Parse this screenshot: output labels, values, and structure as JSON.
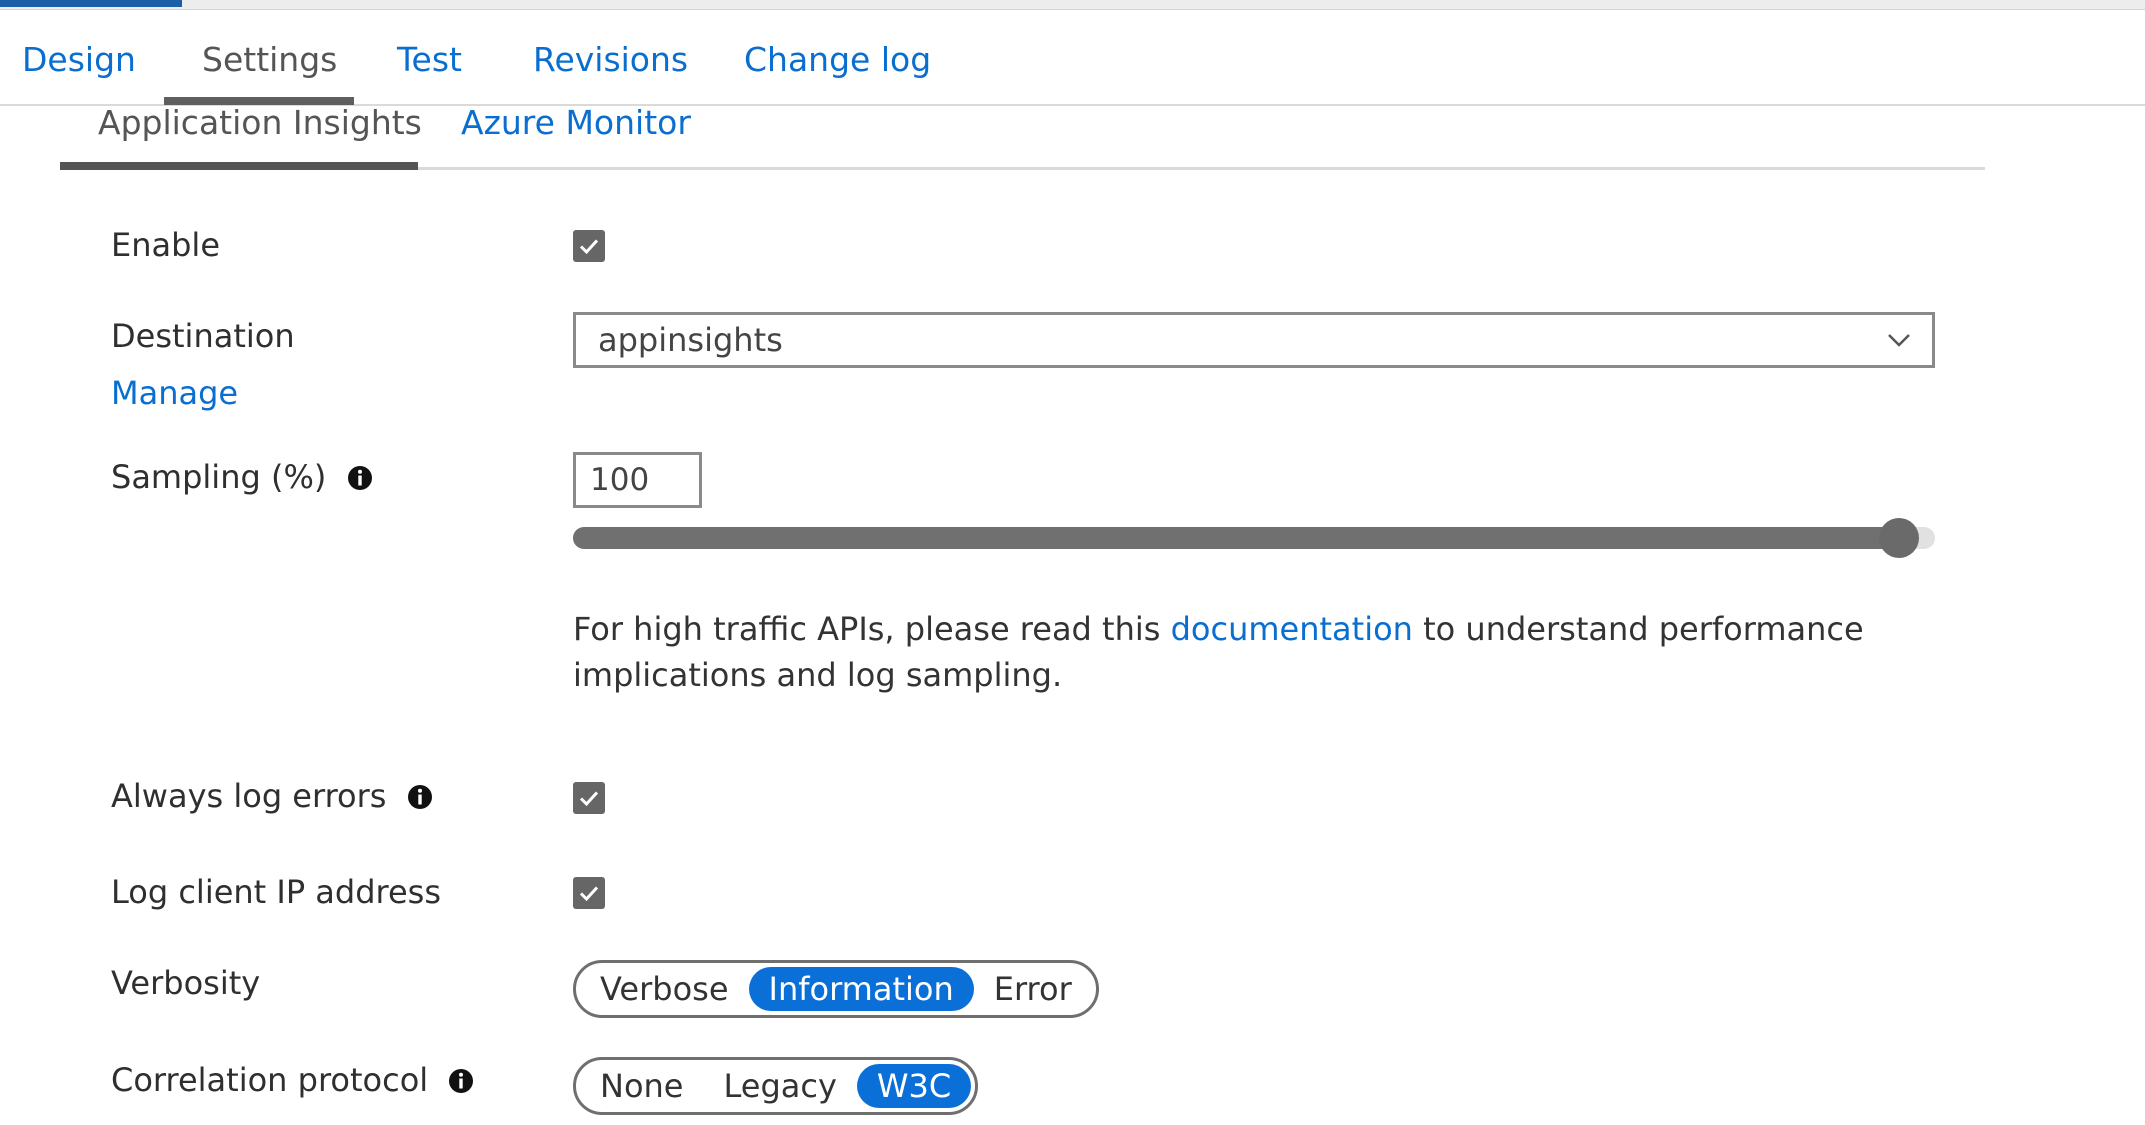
{
  "tabs": [
    {
      "label": "Design",
      "active": false
    },
    {
      "label": "Settings",
      "active": true
    },
    {
      "label": "Test",
      "active": false
    },
    {
      "label": "Revisions",
      "active": false
    },
    {
      "label": "Change log",
      "active": false
    }
  ],
  "subtabs": [
    {
      "label": "Application Insights",
      "active": true
    },
    {
      "label": "Azure Monitor",
      "active": false
    }
  ],
  "form": {
    "enable": {
      "label": "Enable",
      "checked": true
    },
    "destination": {
      "label": "Destination",
      "manage_link": "Manage",
      "value": "appinsights"
    },
    "sampling": {
      "label": "Sampling (%)",
      "value": "100",
      "slider_percent": 100,
      "help_before": "For high traffic APIs, please read this ",
      "help_link": "documentation",
      "help_after": " to understand performance implications and log sampling."
    },
    "always_log_errors": {
      "label": "Always log errors",
      "checked": true
    },
    "log_client_ip": {
      "label": "Log client IP address",
      "checked": true
    },
    "verbosity": {
      "label": "Verbosity",
      "options": [
        "Verbose",
        "Information",
        "Error"
      ],
      "selected": "Information"
    },
    "correlation": {
      "label": "Correlation protocol",
      "options": [
        "None",
        "Legacy",
        "W3C"
      ],
      "selected": "W3C"
    }
  },
  "colors": {
    "link": "#0a6ed1",
    "selected_segment": "#0a70d8",
    "checkbox": "#666666",
    "slider_fill": "#707070"
  },
  "icons": {
    "info": "info-circle-icon",
    "check": "checkmark-icon",
    "chevron": "chevron-down-icon"
  }
}
